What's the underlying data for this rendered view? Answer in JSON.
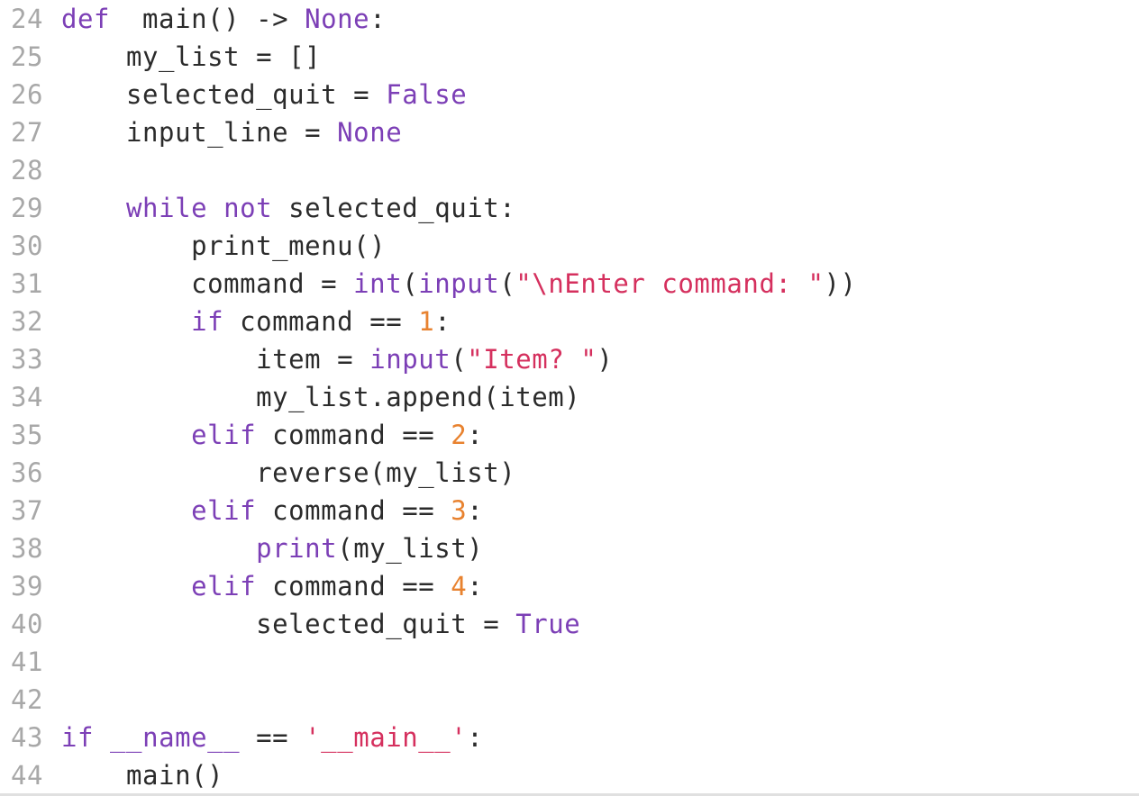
{
  "editor": {
    "language": "python",
    "colors": {
      "keyword": "#7c3fb6",
      "string": "#d5305e",
      "number": "#e8822f",
      "default": "#2b2b2b",
      "line_number": "#a8a8a8"
    },
    "lines": [
      {
        "num": "24",
        "tokens": [
          [
            "kw",
            "def"
          ],
          [
            "",
            "  main() -> "
          ],
          [
            "kw",
            "None"
          ],
          [
            "",
            ":"
          ]
        ]
      },
      {
        "num": "25",
        "tokens": [
          [
            "",
            "    my_list = []"
          ]
        ]
      },
      {
        "num": "26",
        "tokens": [
          [
            "",
            "    selected_quit = "
          ],
          [
            "kw",
            "False"
          ]
        ]
      },
      {
        "num": "27",
        "tokens": [
          [
            "",
            "    input_line = "
          ],
          [
            "kw",
            "None"
          ]
        ]
      },
      {
        "num": "28",
        "tokens": []
      },
      {
        "num": "29",
        "tokens": [
          [
            "",
            "    "
          ],
          [
            "kw",
            "while"
          ],
          [
            "",
            " "
          ],
          [
            "kw",
            "not"
          ],
          [
            "",
            " selected_quit:"
          ]
        ]
      },
      {
        "num": "30",
        "tokens": [
          [
            "",
            "        print_menu()"
          ]
        ]
      },
      {
        "num": "31",
        "tokens": [
          [
            "",
            "        command = "
          ],
          [
            "kw",
            "int"
          ],
          [
            "",
            "("
          ],
          [
            "kw",
            "input"
          ],
          [
            "",
            "("
          ],
          [
            "str",
            "\"\\nEnter command: \""
          ],
          [
            "",
            "))"
          ]
        ]
      },
      {
        "num": "32",
        "tokens": [
          [
            "",
            "        "
          ],
          [
            "kw",
            "if"
          ],
          [
            "",
            " command == "
          ],
          [
            "num",
            "1"
          ],
          [
            "",
            ":"
          ]
        ]
      },
      {
        "num": "33",
        "tokens": [
          [
            "",
            "            item = "
          ],
          [
            "kw",
            "input"
          ],
          [
            "",
            "("
          ],
          [
            "str",
            "\"Item? \""
          ],
          [
            "",
            ")"
          ]
        ]
      },
      {
        "num": "34",
        "tokens": [
          [
            "",
            "            my_list.append(item)"
          ]
        ]
      },
      {
        "num": "35",
        "tokens": [
          [
            "",
            "        "
          ],
          [
            "kw",
            "elif"
          ],
          [
            "",
            " command == "
          ],
          [
            "num",
            "2"
          ],
          [
            "",
            ":"
          ]
        ]
      },
      {
        "num": "36",
        "tokens": [
          [
            "",
            "            reverse(my_list)"
          ]
        ]
      },
      {
        "num": "37",
        "tokens": [
          [
            "",
            "        "
          ],
          [
            "kw",
            "elif"
          ],
          [
            "",
            " command == "
          ],
          [
            "num",
            "3"
          ],
          [
            "",
            ":"
          ]
        ]
      },
      {
        "num": "38",
        "tokens": [
          [
            "",
            "            "
          ],
          [
            "kw",
            "print"
          ],
          [
            "",
            "(my_list)"
          ]
        ]
      },
      {
        "num": "39",
        "tokens": [
          [
            "",
            "        "
          ],
          [
            "kw",
            "elif"
          ],
          [
            "",
            " command == "
          ],
          [
            "num",
            "4"
          ],
          [
            "",
            ":"
          ]
        ]
      },
      {
        "num": "40",
        "tokens": [
          [
            "",
            "            selected_quit = "
          ],
          [
            "kw",
            "True"
          ]
        ]
      },
      {
        "num": "41",
        "tokens": []
      },
      {
        "num": "42",
        "tokens": []
      },
      {
        "num": "43",
        "tokens": [
          [
            "kw",
            "if"
          ],
          [
            "",
            " "
          ],
          [
            "kw",
            "__name__"
          ],
          [
            "",
            " == "
          ],
          [
            "str",
            "'__main__'"
          ],
          [
            "",
            ":"
          ]
        ]
      },
      {
        "num": "44",
        "tokens": [
          [
            "",
            "    main()"
          ]
        ]
      }
    ]
  }
}
